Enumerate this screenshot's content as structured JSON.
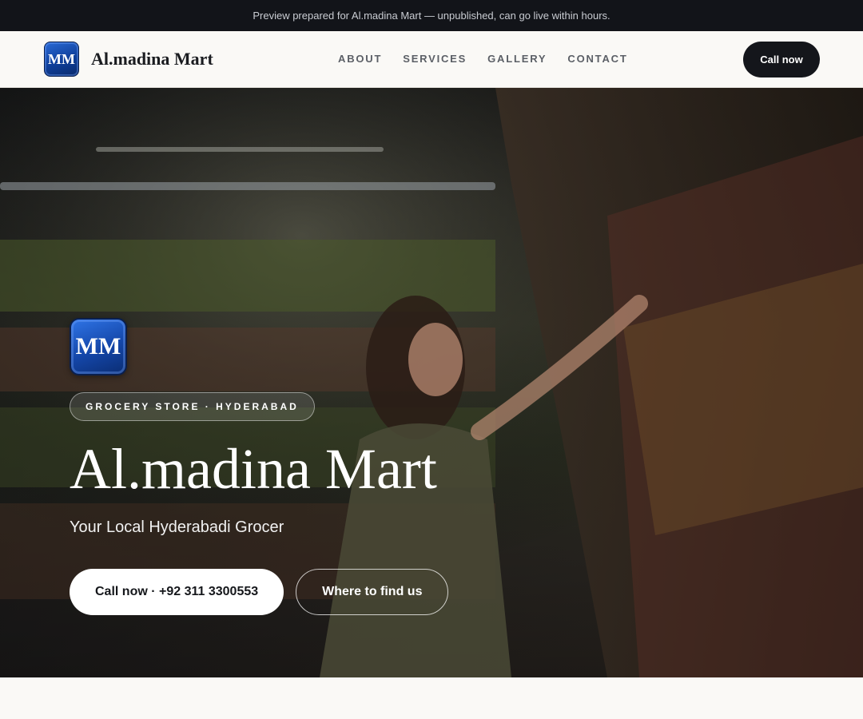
{
  "topbar": {
    "text": "Preview prepared for Al.madina Mart — unpublished, can go live within hours."
  },
  "nav": {
    "logo_text": "MM",
    "brand_name": "Al.madina Mart",
    "links": [
      "ABOUT",
      "SERVICES",
      "GALLERY",
      "CONTACT"
    ],
    "cta_label": "Call now"
  },
  "hero": {
    "logo_text": "MM",
    "badge": "GROCERY STORE · HYDERABAD",
    "title": "Al.madina Mart",
    "subtitle": "Your Local Hyderabadi Grocer",
    "primary_button": "Call now · +92 311 3300553",
    "secondary_button": "Where to find us"
  },
  "colors": {
    "topbar_bg": "#121419",
    "nav_bg": "#faf9f6",
    "cta_bg": "#14161b",
    "logo_blue": "#1446a8"
  }
}
